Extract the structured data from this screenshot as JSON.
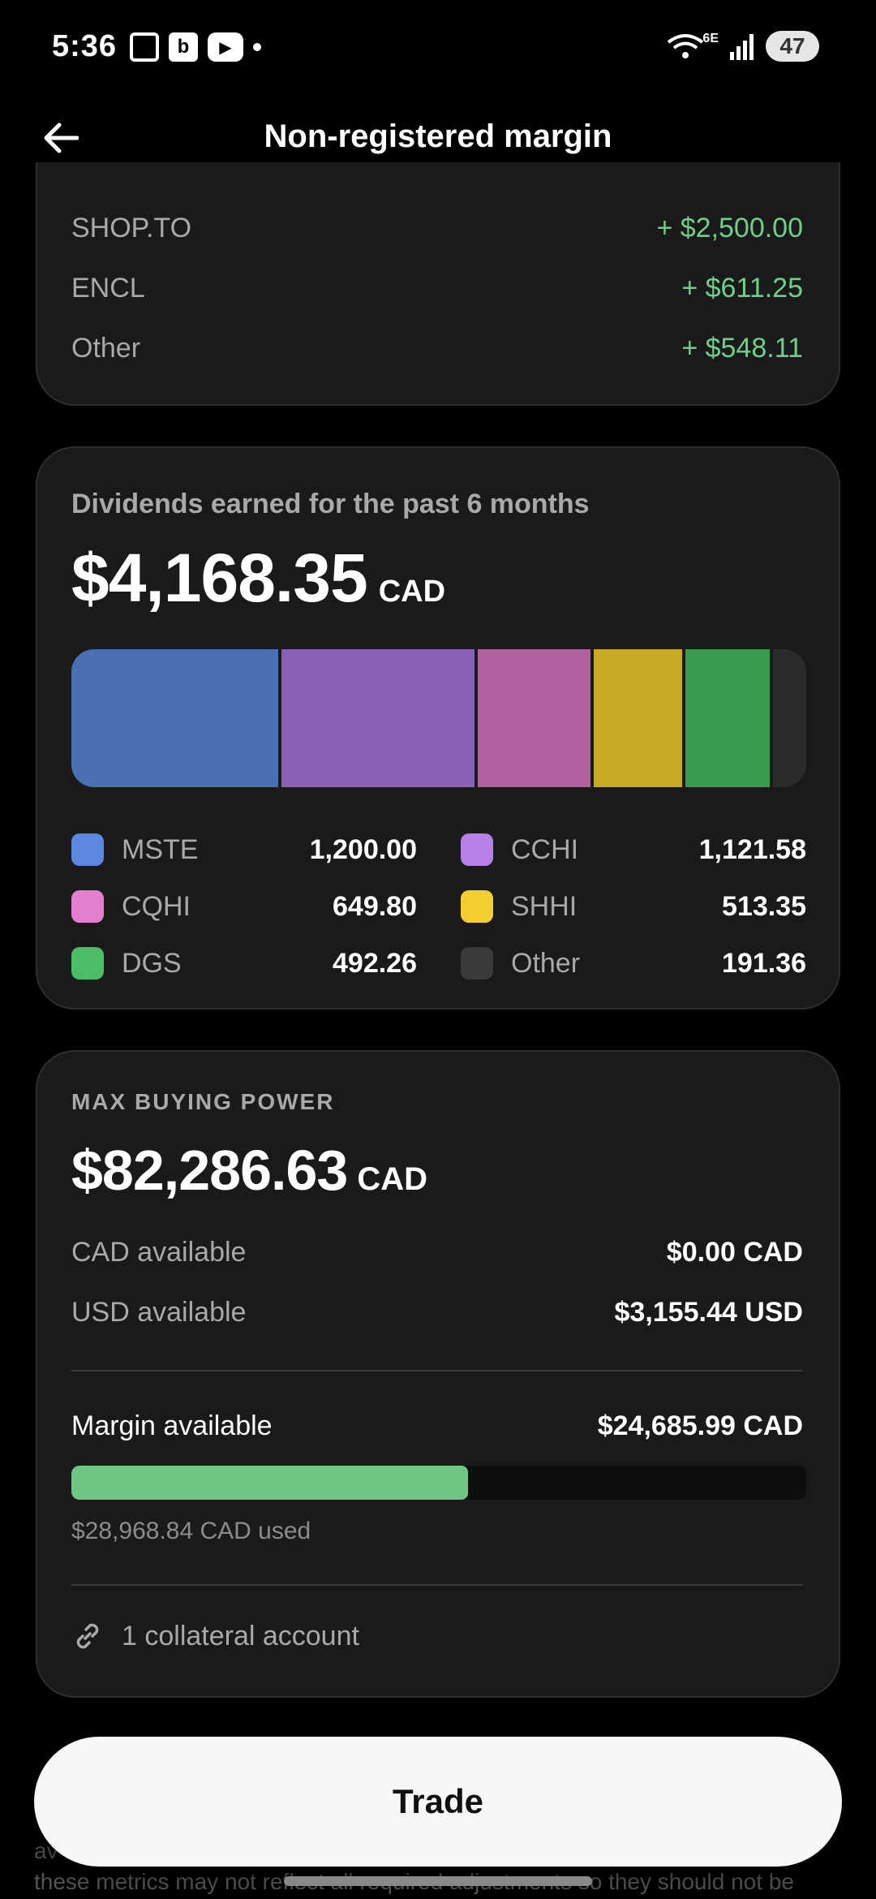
{
  "status_bar": {
    "time": "5:36",
    "network": "6E",
    "battery": "47",
    "icons": [
      "screenshot-icon",
      "b-app-icon",
      "youtube-icon",
      "notification-dot-icon",
      "wifi-icon",
      "signal-icon",
      "battery-icon"
    ]
  },
  "header": {
    "title": "Non-registered margin"
  },
  "gains": [
    {
      "symbol": "SHOP.TO",
      "value": "+ $2,500.00"
    },
    {
      "symbol": "ENCL",
      "value": "+ $611.25"
    },
    {
      "symbol": "Other",
      "value": "+ $548.11"
    }
  ],
  "dividends": {
    "title": "Dividends earned for the past 6 months",
    "amount": "$4,168.35",
    "currency": "CAD",
    "segments": [
      {
        "symbol": "MSTE",
        "value": 1200.0,
        "color": "#4a6fb3"
      },
      {
        "symbol": "CCHI",
        "value": 1121.58,
        "color": "#8a5fb6"
      },
      {
        "symbol": "CQHI",
        "value": 649.8,
        "color": "#b05f9f"
      },
      {
        "symbol": "SHHI",
        "value": 513.35,
        "color": "#c9a825"
      },
      {
        "symbol": "DGS",
        "value": 492.26,
        "color": "#3a9a4e"
      },
      {
        "symbol": "Other",
        "value": 191.36,
        "color": "#2b2b2b"
      }
    ],
    "legend": [
      {
        "symbol": "MSTE",
        "value": "1,200.00",
        "color": "#5b87e0"
      },
      {
        "symbol": "CCHI",
        "value": "1,121.58",
        "color": "#b681e8"
      },
      {
        "symbol": "CQHI",
        "value": "649.80",
        "color": "#e27fcf"
      },
      {
        "symbol": "SHHI",
        "value": "513.35",
        "color": "#f2cf2e"
      },
      {
        "symbol": "DGS",
        "value": "492.26",
        "color": "#4cbc66"
      },
      {
        "symbol": "Other",
        "value": "191.36",
        "color": "#3a3a3a"
      }
    ]
  },
  "buying_power": {
    "label": "MAX BUYING POWER",
    "amount": "$82,286.63",
    "currency": "CAD",
    "cad_available_label": "CAD available",
    "cad_available_value": "$0.00 CAD",
    "usd_available_label": "USD available",
    "usd_available_value": "$3,155.44 USD",
    "margin_label": "Margin available",
    "margin_value": "$24,685.99 CAD",
    "margin_used_fraction": 0.54,
    "used_text": "$28,968.84 CAD used",
    "collateral_text": "1 collateral account"
  },
  "trade_button": "Trade",
  "disclaimer": {
    "line1": "av",
    "line2": "these metrics may not reflect all required adjustments so they should not be"
  }
}
